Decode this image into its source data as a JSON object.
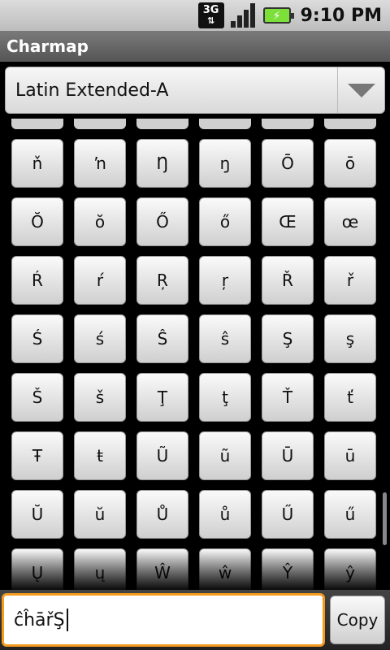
{
  "status_bar": {
    "network_label": "3G",
    "network_icon": "network-3g-icon",
    "signal_icon": "signal-strength-icon",
    "battery_icon": "battery-charging-icon",
    "time": "9:10 PM"
  },
  "app": {
    "title": "Charmap"
  },
  "spinner": {
    "selected": "Latin Extended-A",
    "arrow_icon": "dropdown-arrow-icon"
  },
  "grid": {
    "rows": [
      [
        "ň",
        "ŉ",
        "Ŋ",
        "ŋ",
        "Ō",
        "ō"
      ],
      [
        "Ŏ",
        "ŏ",
        "Ő",
        "ő",
        "Œ",
        "œ"
      ],
      [
        "Ŕ",
        "ŕ",
        "Ŗ",
        "ŗ",
        "Ř",
        "ř"
      ],
      [
        "Ś",
        "ś",
        "Ŝ",
        "ŝ",
        "Ş",
        "ş"
      ],
      [
        "Š",
        "š",
        "Ţ",
        "ţ",
        "Ť",
        "ť"
      ],
      [
        "Ŧ",
        "ŧ",
        "Ũ",
        "ũ",
        "Ū",
        "ū"
      ],
      [
        "Ŭ",
        "ŭ",
        "Ů",
        "ů",
        "Ű",
        "ű"
      ],
      [
        "Ų",
        "ų",
        "Ŵ",
        "ŵ",
        "Ŷ",
        "ŷ"
      ]
    ]
  },
  "input": {
    "value": "ĉĥāřŞ"
  },
  "copy_button": {
    "label": "Copy"
  }
}
